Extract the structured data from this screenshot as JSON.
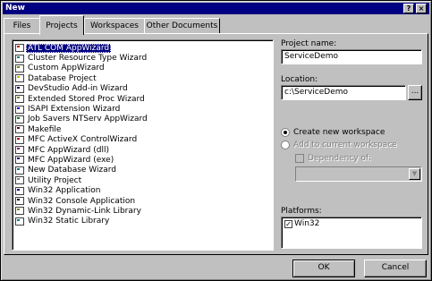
{
  "window": {
    "title": "New",
    "help_glyph": "?",
    "close_glyph": "×"
  },
  "tabs": [
    {
      "label": "Files"
    },
    {
      "label": "Projects"
    },
    {
      "label": "Workspaces"
    },
    {
      "label": "Other Documents"
    }
  ],
  "projects": [
    {
      "label": "ATL COM AppWizard",
      "icon": "atl-icon",
      "color": "#c00000"
    },
    {
      "label": "Cluster Resource Type Wizard",
      "icon": "cluster-icon",
      "color": "#008080"
    },
    {
      "label": "Custom AppWizard",
      "icon": "wizard-icon",
      "color": "#808000"
    },
    {
      "label": "Database Project",
      "icon": "database-icon",
      "color": "#c0c000"
    },
    {
      "label": "DevStudio Add-in Wizard",
      "icon": "addin-icon",
      "color": "#000080"
    },
    {
      "label": "Extended Stored Proc Wizard",
      "icon": "stored-proc-icon",
      "color": "#808000"
    },
    {
      "label": "ISAPI Extension Wizard",
      "icon": "globe-icon",
      "color": "#0000c0"
    },
    {
      "label": "Job Savers NTServ AppWizard",
      "icon": "service-icon",
      "color": "#008000"
    },
    {
      "label": "Makefile",
      "icon": "makefile-icon",
      "color": "#800000"
    },
    {
      "label": "MFC ActiveX ControlWizard",
      "icon": "activex-icon",
      "color": "#c00000"
    },
    {
      "label": "MFC AppWizard (dll)",
      "icon": "mfc-dll-icon",
      "color": "#800080"
    },
    {
      "label": "MFC AppWizard (exe)",
      "icon": "mfc-exe-icon",
      "color": "#000080"
    },
    {
      "label": "New Database Wizard",
      "icon": "new-db-icon",
      "color": "#008080"
    },
    {
      "label": "Utility Project",
      "icon": "utility-icon",
      "color": "#808080"
    },
    {
      "label": "Win32 Application",
      "icon": "win32-app-icon",
      "color": "#000080"
    },
    {
      "label": "Win32 Console Application",
      "icon": "console-icon",
      "color": "#000000"
    },
    {
      "label": "Win32 Dynamic-Link Library",
      "icon": "dll-icon",
      "color": "#808000"
    },
    {
      "label": "Win32 Static Library",
      "icon": "lib-icon",
      "color": "#008080"
    }
  ],
  "project_name": {
    "label": "Project name:",
    "value": "ServiceDemo"
  },
  "location": {
    "label": "Location:",
    "value": "c:\\ServiceDemo",
    "browse": "..."
  },
  "workspace": {
    "create": "Create new workspace",
    "add": "Add to current workspace",
    "dependency": "Dependency of:",
    "dependency_value": ""
  },
  "platforms": {
    "label": "Platforms:",
    "items": [
      "Win32"
    ]
  },
  "buttons": {
    "ok": "OK",
    "cancel": "Cancel"
  }
}
